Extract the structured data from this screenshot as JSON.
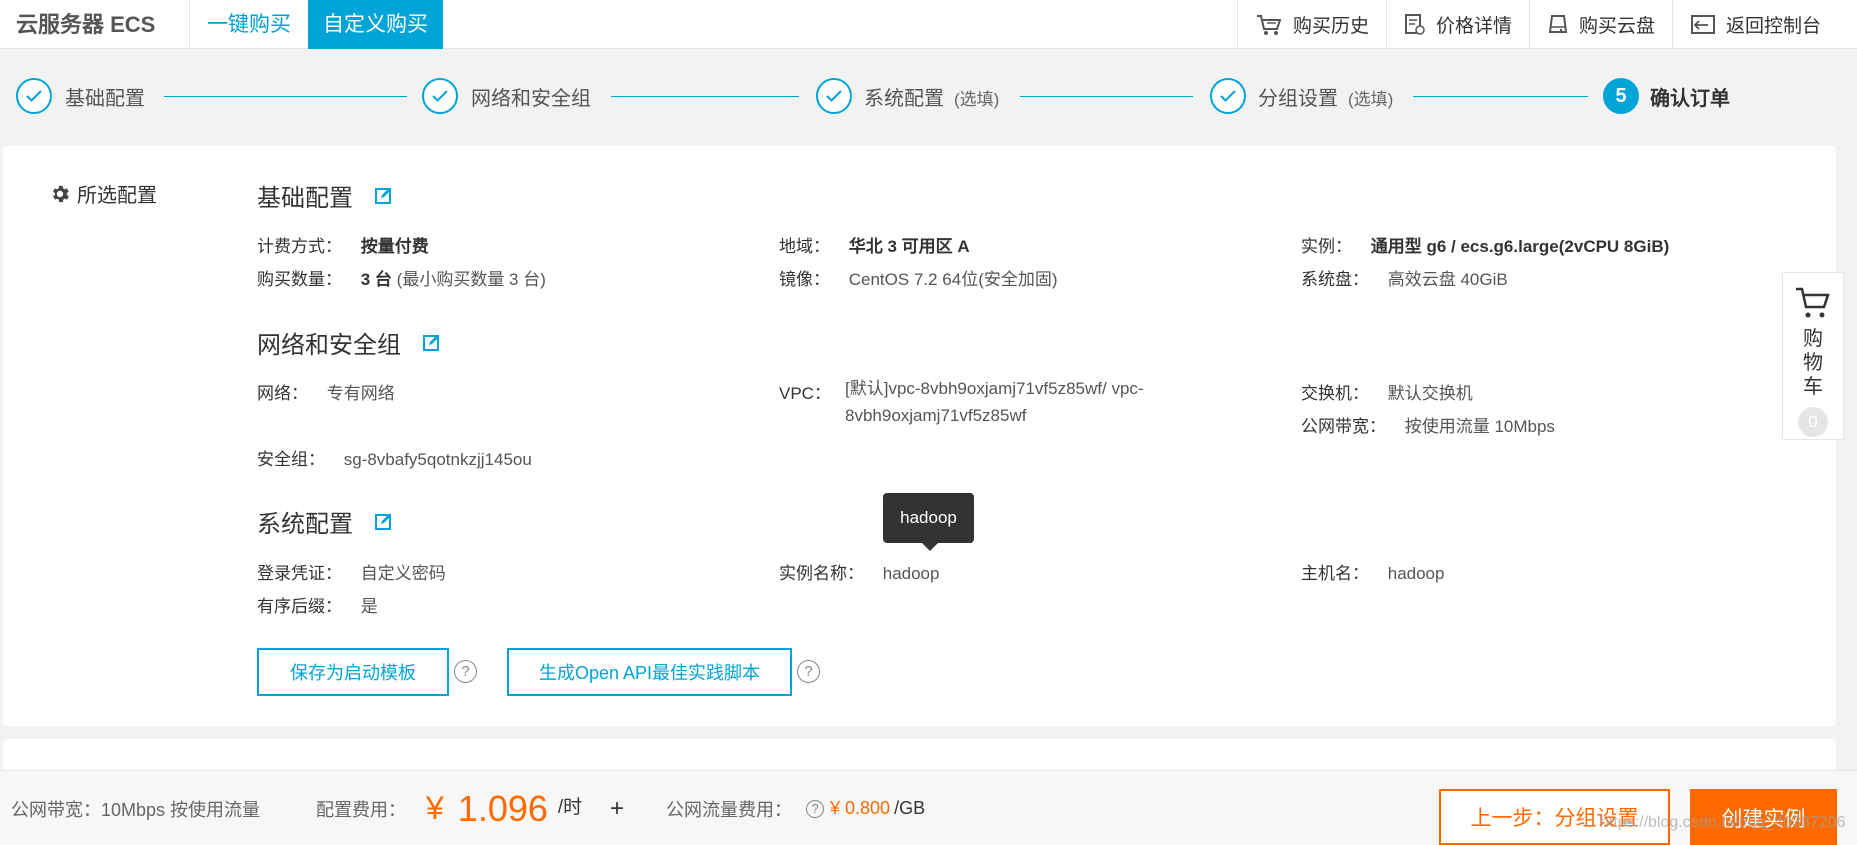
{
  "header": {
    "brand": "云服务器 ECS",
    "tabs": [
      {
        "label": "一键购买"
      },
      {
        "label": "自定义购买"
      }
    ],
    "actions": [
      {
        "label": "购买历史",
        "icon": "cart-history-icon"
      },
      {
        "label": "价格详情",
        "icon": "price-detail-icon"
      },
      {
        "label": "购买云盘",
        "icon": "disk-icon"
      },
      {
        "label": "返回控制台",
        "icon": "console-back-icon"
      }
    ]
  },
  "steps": [
    {
      "label": "基础配置",
      "optional": "",
      "state": "done"
    },
    {
      "label": "网络和安全组",
      "optional": "",
      "state": "done"
    },
    {
      "label": "系统配置",
      "optional": "(选填)",
      "state": "done"
    },
    {
      "label": "分组设置",
      "optional": "(选填)",
      "state": "done"
    },
    {
      "label": "确认订单",
      "optional": "",
      "state": "active",
      "number": "5"
    }
  ],
  "summary": {
    "title": "所选配置",
    "basic": {
      "title": "基础配置",
      "billing_k": "计费方式：",
      "billing_v": "按量付费",
      "region_k": "地域：",
      "region_v": "华北 3 可用区 A",
      "instance_k": "实例：",
      "instance_v": "通用型 g6 / ecs.g6.large(2vCPU 8GiB)",
      "quantity_k": "购买数量：",
      "quantity_v": "3 台",
      "quantity_sub": "(最小购买数量 3 台)",
      "image_k": "镜像：",
      "image_v": "CentOS 7.2 64位(安全加固)",
      "disk_k": "系统盘：",
      "disk_v": "高效云盘 40GiB"
    },
    "network": {
      "title": "网络和安全组",
      "net_k": "网络：",
      "net_v": "专有网络",
      "vpc_k": "VPC：",
      "vpc_v1": "[默认]vpc-8vbh9oxjamj71vf5z85wf/ vpc-",
      "vpc_v2": "8vbh9oxjamj71vf5z85wf",
      "switch_k": "交换机：",
      "switch_v": "默认交换机",
      "bandwidth_k": "公网带宽：",
      "bandwidth_v": "按使用流量 10Mbps",
      "sg_k": "安全组：",
      "sg_v": "sg-8vbafy5qotnkzjj145ou"
    },
    "system": {
      "title": "系统配置",
      "login_k": "登录凭证：",
      "login_v": "自定义密码",
      "instname_k": "实例名称：",
      "instname_v": "hadoop",
      "hostname_k": "主机名：",
      "hostname_v": "hadoop",
      "suffix_k": "有序后缀：",
      "suffix_v": "是"
    },
    "tooltip": "hadoop",
    "buttons": {
      "save_template": "保存为启动模板",
      "gen_script": "生成Open API最佳实践脚本",
      "help": "?"
    }
  },
  "cart": {
    "label": "购物车",
    "count": "0"
  },
  "footer": {
    "bandwidth": "公网带宽：10Mbps 按使用流量",
    "config_fee_label": "配置费用：",
    "currency": "¥",
    "config_fee": "1.096",
    "config_unit": "/时",
    "plus": "+",
    "flow_fee_label": "公网流量费用：",
    "flow_help": "?",
    "flow_fee": "¥ 0.800",
    "flow_unit": "/GB",
    "prev_button": "上一步：分组设置",
    "create_button": "创建实例",
    "watermark": "https://blog.csdn.net/qq_40387206"
  },
  "colors": {
    "accent": "#00a4d6",
    "orange": "#ff6a00"
  }
}
